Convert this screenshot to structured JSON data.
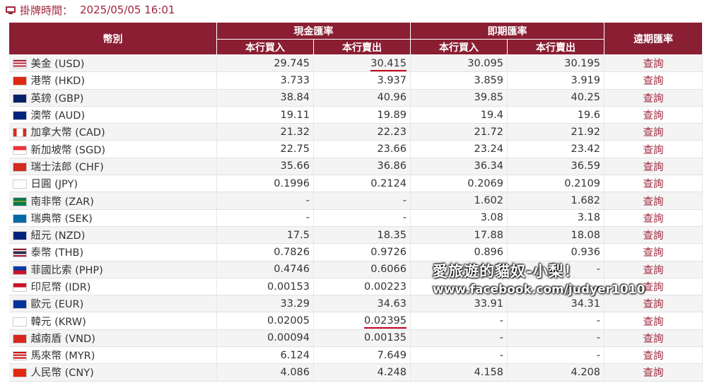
{
  "header": {
    "label": "掛牌時間：",
    "datetime": "2025/05/05 16:01"
  },
  "table": {
    "col_currency": "幣別",
    "group_cash": "現金匯率",
    "group_spot": "即期匯率",
    "col_forward": "遠期匯率",
    "sub_buy": "本行買入",
    "sub_sell": "本行賣出",
    "rows": [
      {
        "name": "美金 (USD)",
        "cash_buy": "29.745",
        "cash_sell": "30.415",
        "spot_buy": "30.095",
        "spot_sell": "30.195",
        "forward": "查詢"
      },
      {
        "name": "港幣 (HKD)",
        "cash_buy": "3.733",
        "cash_sell": "3.937",
        "spot_buy": "3.859",
        "spot_sell": "3.919",
        "forward": "查詢"
      },
      {
        "name": "英鎊 (GBP)",
        "cash_buy": "38.84",
        "cash_sell": "40.96",
        "spot_buy": "39.85",
        "spot_sell": "40.25",
        "forward": "查詢"
      },
      {
        "name": "澳幣 (AUD)",
        "cash_buy": "19.11",
        "cash_sell": "19.89",
        "spot_buy": "19.4",
        "spot_sell": "19.6",
        "forward": "查詢"
      },
      {
        "name": "加拿大幣 (CAD)",
        "cash_buy": "21.32",
        "cash_sell": "22.23",
        "spot_buy": "21.72",
        "spot_sell": "21.92",
        "forward": "查詢"
      },
      {
        "name": "新加坡幣 (SGD)",
        "cash_buy": "22.75",
        "cash_sell": "23.66",
        "spot_buy": "23.24",
        "spot_sell": "23.42",
        "forward": "查詢"
      },
      {
        "name": "瑞士法郎 (CHF)",
        "cash_buy": "35.66",
        "cash_sell": "36.86",
        "spot_buy": "36.34",
        "spot_sell": "36.59",
        "forward": "查詢"
      },
      {
        "name": "日圓 (JPY)",
        "cash_buy": "0.1996",
        "cash_sell": "0.2124",
        "spot_buy": "0.2069",
        "spot_sell": "0.2109",
        "forward": "查詢"
      },
      {
        "name": "南非幣 (ZAR)",
        "cash_buy": "-",
        "cash_sell": "-",
        "spot_buy": "1.602",
        "spot_sell": "1.682",
        "forward": "查詢"
      },
      {
        "name": "瑞典幣 (SEK)",
        "cash_buy": "-",
        "cash_sell": "-",
        "spot_buy": "3.08",
        "spot_sell": "3.18",
        "forward": "查詢"
      },
      {
        "name": "紐元 (NZD)",
        "cash_buy": "17.5",
        "cash_sell": "18.35",
        "spot_buy": "17.88",
        "spot_sell": "18.08",
        "forward": "查詢"
      },
      {
        "name": "泰幣 (THB)",
        "cash_buy": "0.7826",
        "cash_sell": "0.9726",
        "spot_buy": "0.896",
        "spot_sell": "0.936",
        "forward": "查詢"
      },
      {
        "name": "菲國比索 (PHP)",
        "cash_buy": "0.4746",
        "cash_sell": "0.6066",
        "spot_buy": "-",
        "spot_sell": "-",
        "forward": "查詢"
      },
      {
        "name": "印尼幣 (IDR)",
        "cash_buy": "0.00153",
        "cash_sell": "0.00223",
        "spot_buy": "-",
        "spot_sell": "-",
        "forward": "查詢"
      },
      {
        "name": "歐元 (EUR)",
        "cash_buy": "33.29",
        "cash_sell": "34.63",
        "spot_buy": "33.91",
        "spot_sell": "34.31",
        "forward": "查詢"
      },
      {
        "name": "韓元 (KRW)",
        "cash_buy": "0.02005",
        "cash_sell": "0.02395",
        "spot_buy": "-",
        "spot_sell": "-",
        "forward": "查詢"
      },
      {
        "name": "越南盾 (VND)",
        "cash_buy": "0.00094",
        "cash_sell": "0.00135",
        "spot_buy": "-",
        "spot_sell": "-",
        "forward": "查詢"
      },
      {
        "name": "馬來幣 (MYR)",
        "cash_buy": "6.124",
        "cash_sell": "7.649",
        "spot_buy": "-",
        "spot_sell": "-",
        "forward": "查詢"
      },
      {
        "name": "人民幣 (CNY)",
        "cash_buy": "4.086",
        "cash_sell": "4.248",
        "spot_buy": "4.158",
        "spot_sell": "4.208",
        "forward": "查詢"
      }
    ]
  },
  "watermark": {
    "line1": "愛旅遊的貓奴-小梨！",
    "line2": "www.facebook.com/judyer1010"
  },
  "colors": {
    "accent": "#8a1e33",
    "link": "#a0253b",
    "underline": "#c0001a"
  }
}
